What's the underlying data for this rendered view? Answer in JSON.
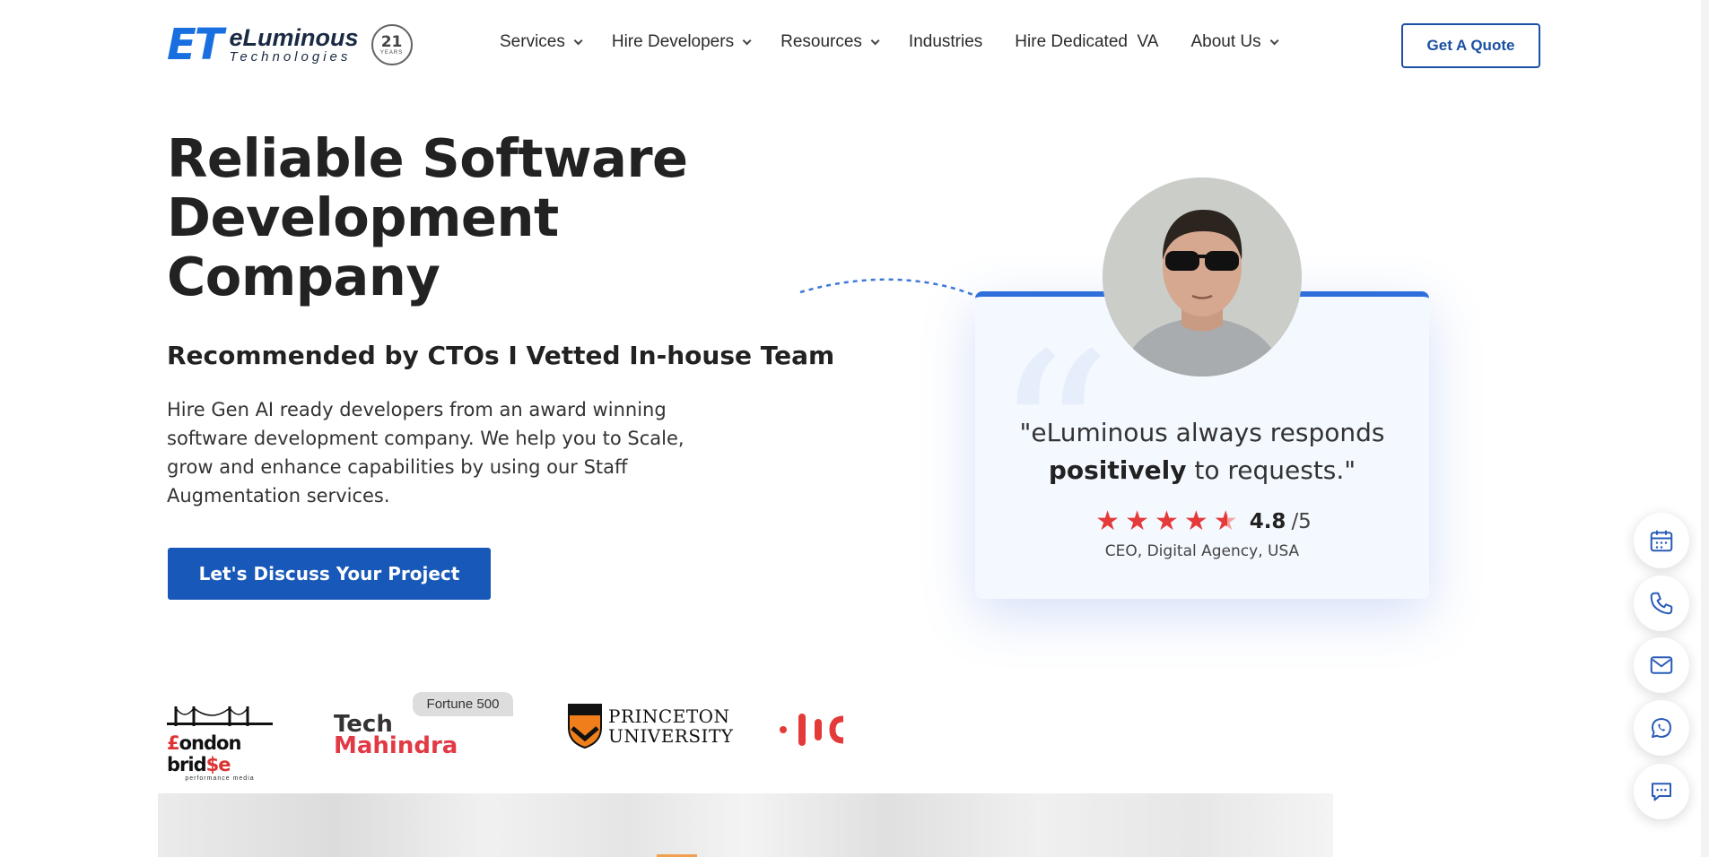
{
  "brand": {
    "mark": "ET",
    "name": "eLuminous",
    "subtitle": "Technologies",
    "badge_number": "21",
    "badge_label": "YEARS"
  },
  "nav": {
    "items": [
      {
        "label": "Services",
        "has_dropdown": true
      },
      {
        "label": "Hire Developers",
        "has_dropdown": true
      },
      {
        "label": "Resources",
        "has_dropdown": true
      },
      {
        "label": "Industries",
        "has_dropdown": false
      },
      {
        "label": "Hire Dedicated  VA",
        "has_dropdown": false
      },
      {
        "label": "About Us",
        "has_dropdown": true
      }
    ],
    "quote_button": "Get A Quote"
  },
  "hero": {
    "title": "Reliable Software Development Company",
    "subtitle": "Recommended by CTOs I Vetted In-house Team",
    "description": "Hire Gen AI ready developers from an award winning software development company. We help you to Scale, grow and enhance capabilities by using our Staff Augmentation services.",
    "cta": "Let's Discuss Your Project"
  },
  "testimonial": {
    "quote_start": "\"eLuminous always responds",
    "quote_bold": "positively",
    "quote_end": " to requests.\"",
    "rating_value": "4.8",
    "rating_max": "/5",
    "rating_stars": 4.8,
    "author": "CEO, Digital Agency, USA"
  },
  "clients": {
    "london_bridge": {
      "name_prefix": "£",
      "name": "ondon brid",
      "name_suffix": "$e",
      "tagline": "performance media"
    },
    "tech_mahindra": {
      "badge": "Fortune 500",
      "line1": "Tech",
      "line2": "Mahindra"
    },
    "princeton": {
      "line1": "PRINCETON",
      "line2": "UNIVERSITY"
    }
  },
  "colors": {
    "primary": "#1758b8",
    "brand_blue": "#1a6fe0",
    "star_red": "#e43a3a",
    "card_bg": "#f4f8ff",
    "card_border": "#2f6fdc"
  },
  "floating_actions": [
    {
      "icon": "calendar-icon"
    },
    {
      "icon": "phone-icon"
    },
    {
      "icon": "mail-icon"
    },
    {
      "icon": "whatsapp-icon"
    },
    {
      "icon": "chat-icon"
    }
  ]
}
